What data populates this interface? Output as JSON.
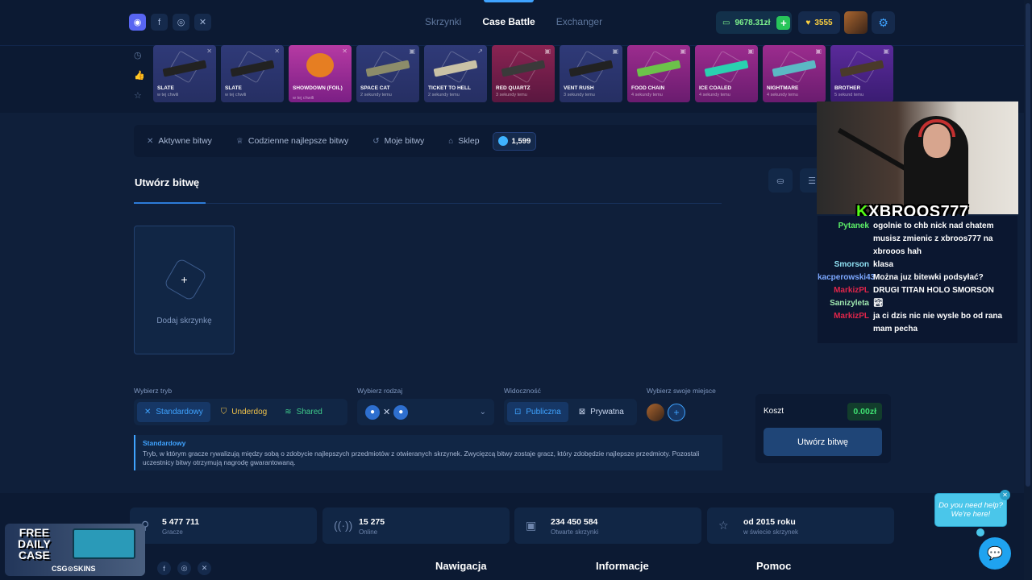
{
  "nav": {
    "links": [
      "Skrzynki",
      "Case Battle",
      "Exchanger"
    ],
    "balance": "9678.31zł",
    "coins": "3555",
    "icons": {
      "discord": "discord-icon",
      "facebook": "facebook-icon",
      "instagram": "instagram-icon",
      "x": "x-icon",
      "settings": "gear-icon"
    }
  },
  "live_drops": [
    {
      "name": "SLATE",
      "time": "w tej chwili"
    },
    {
      "name": "SLATE",
      "time": "w tej chwili"
    },
    {
      "name": "SHOWDOWN (FOIL)",
      "time": "w tej chwili"
    },
    {
      "name": "SPACE CAT",
      "time": "2 sekundy temu"
    },
    {
      "name": "TICKET TO HELL",
      "time": "2 sekundy temu"
    },
    {
      "name": "RED QUARTZ",
      "time": "3 sekundy temu"
    },
    {
      "name": "VENT RUSH",
      "time": "3 sekundy temu"
    },
    {
      "name": "FOOD CHAIN",
      "time": "4 sekundy temu"
    },
    {
      "name": "ICE COALED",
      "time": "4 sekundy temu"
    },
    {
      "name": "NIGHTMARE",
      "time": "4 sekundy temu"
    },
    {
      "name": "BROTHER",
      "time": "5 sekund temu"
    }
  ],
  "tabs": {
    "active_battles": "Aktywne bitwy",
    "daily_best": "Codzienne najlepsze bitwy",
    "my_battles": "Moje bitwy",
    "shop": "Sklep",
    "points": "1,599"
  },
  "create": {
    "title": "Utwórz bitwę",
    "add_case": "Dodaj skrzynkę",
    "mode_label": "Wybierz tryb",
    "modes": [
      "Standardowy",
      "Underdog",
      "Shared"
    ],
    "type_label": "Wybierz rodzaj",
    "visibility_label": "Widoczność",
    "visibility": [
      "Publiczna",
      "Prywatna"
    ],
    "seat_label": "Wybierz swoje miejsce",
    "info_title": "Standardowy",
    "info_text": "Tryb, w którym gracze rywalizują między sobą o zdobycie najlepszych przedmiotów z otwieranych skrzynek. Zwycięzcą bitwy zostaje gracz, który zdobędzie najlepsze przedmioty. Pozostali uczestnicy bitwy otrzymują nagrodę gwarantowaną.",
    "cost_label": "Koszt",
    "cost_value": "0.00zł",
    "create_button": "Utwórz bitwę"
  },
  "stats": [
    {
      "value": "5 477 711",
      "label": "Gracze",
      "icon": "user-icon"
    },
    {
      "value": "15 275",
      "label": "Online",
      "icon": "signal-icon"
    },
    {
      "value": "234 450 584",
      "label": "Otwarte skrzynki",
      "icon": "box-icon"
    },
    {
      "value": "od 2015 roku",
      "label": "w świecie skrzynek",
      "icon": "star-icon"
    }
  ],
  "footer": {
    "headings": [
      "Nawigacja",
      "Informacje",
      "Pomoc"
    ]
  },
  "promo": {
    "line1": "FREE",
    "line2": "DAILY",
    "line3": "CASE",
    "brand": "CSG⊙SKINS"
  },
  "stream": {
    "k": "K",
    "nick": "XBROOS777",
    "chat": [
      {
        "user": "Pytanek",
        "color": "#5df068",
        "text": "ogolnie to chb nick nad chatem musisz zmienic z xbroos777 na xbrooos hah"
      },
      {
        "user": "Smorson",
        "color": "#8fe0f2",
        "text": "klasa"
      },
      {
        "user": "kacperowski43",
        "color": "#7ca8ff",
        "text": "Można juz bitewki podsyłać?"
      },
      {
        "user": "MarkizPL",
        "color": "#e0254a",
        "text": "DRUGI TITAN HOLO SMORSON"
      },
      {
        "user": "Sanizyleta",
        "color": "#9fe8b0",
        "text": "🏞"
      },
      {
        "user": "MarkizPL",
        "color": "#e0254a",
        "text": "ja ci dzis nic nie wysle bo od rana mam pecha"
      }
    ]
  },
  "help": {
    "text1": "Do you need help?",
    "text2": "We're here!"
  }
}
